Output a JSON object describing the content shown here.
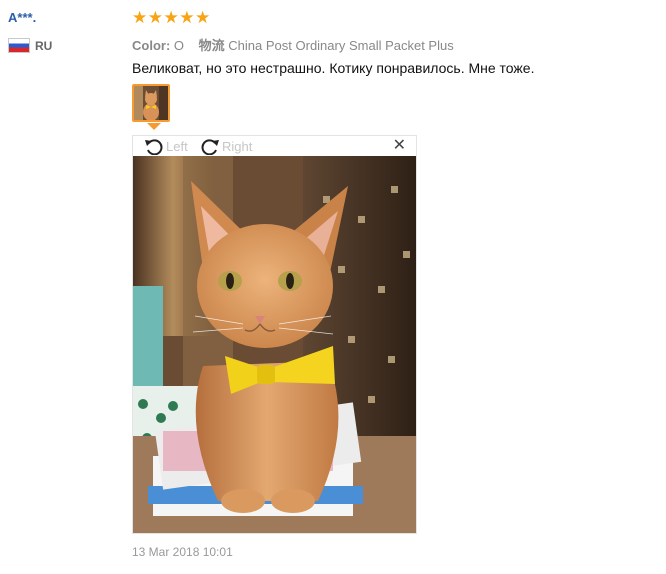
{
  "review": {
    "user_name": "A***.",
    "country": {
      "code": "RU",
      "flag_icon": "russia-flag-icon"
    },
    "rating": 5,
    "star_glyph": "★",
    "star_color": "#f7a415",
    "attributes": [
      {
        "label": "Color:",
        "value": "O"
      },
      {
        "label": "物流",
        "value": "China Post Ordinary Small Packet Plus"
      }
    ],
    "text": "Великоват, но это нестрашно. Котику понравилось. Мне тоже.",
    "date": "13 Mar 2018 10:01"
  },
  "viewer": {
    "rotate_left_label": "Left",
    "rotate_right_label": "Right",
    "close_glyph": "✕",
    "accent_color": "#f59b31"
  }
}
